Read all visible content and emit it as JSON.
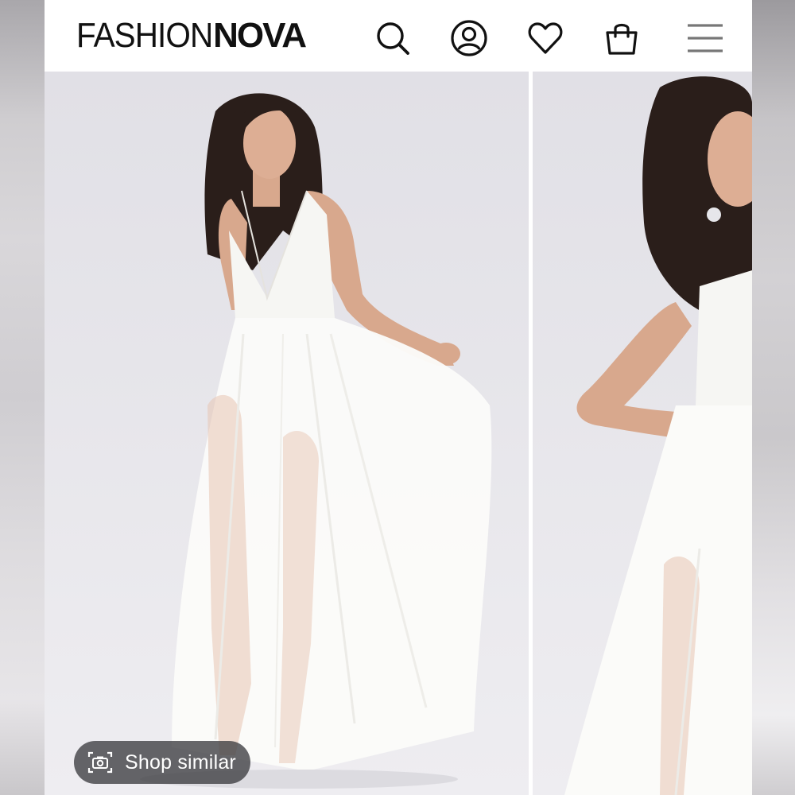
{
  "header": {
    "brand_thin": "FASHION",
    "brand_bold": "NOVA",
    "icons": [
      "search-icon",
      "account-icon",
      "wishlist-heart-icon",
      "shopping-bag-icon",
      "hamburger-menu-icon"
    ]
  },
  "gallery": {
    "images": [
      "product-photo-front",
      "product-photo-side"
    ]
  },
  "shop_similar": {
    "label": "Shop similar",
    "icon": "camera-icon"
  },
  "colors": {
    "header_bg": "#ffffff",
    "icon": "#111111",
    "photo_bg": "#e4e3e8",
    "dress": "#f9f9f7",
    "pill_bg": "#3c3c40"
  }
}
